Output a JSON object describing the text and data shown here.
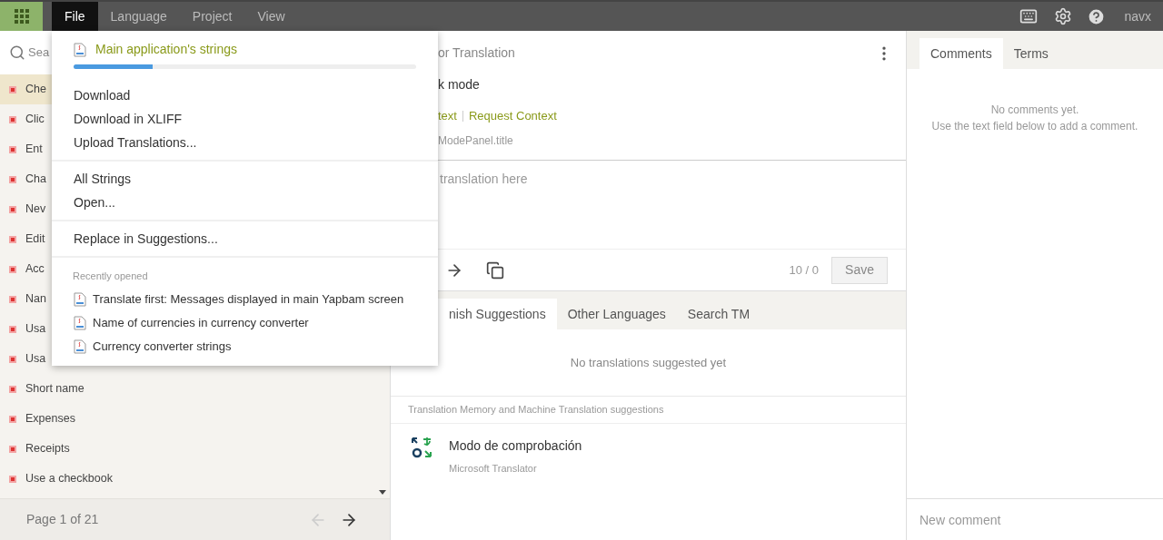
{
  "menubar": {
    "items": [
      {
        "label": "File",
        "selected": true
      },
      {
        "label": "Language",
        "selected": false
      },
      {
        "label": "Project",
        "selected": false
      },
      {
        "label": "View",
        "selected": false
      }
    ],
    "user": "navx"
  },
  "sidebar": {
    "search_placeholder": "Sea",
    "items": [
      {
        "label": "Che",
        "selected": true
      },
      {
        "label": "Clic",
        "selected": false
      },
      {
        "label": "Ent",
        "selected": false
      },
      {
        "label": "Cha",
        "selected": false
      },
      {
        "label": "Nev",
        "selected": false
      },
      {
        "label": "Edit",
        "selected": false
      },
      {
        "label": "Acc",
        "selected": false
      },
      {
        "label": "Nan",
        "selected": false
      },
      {
        "label": "Usa",
        "selected": false
      },
      {
        "label": "Usa",
        "selected": false
      },
      {
        "label": "Short name",
        "selected": false
      },
      {
        "label": "Expenses",
        "selected": false
      },
      {
        "label": "Receipts",
        "selected": false
      },
      {
        "label": "Use a checkbook",
        "selected": false
      }
    ],
    "pager": "Page 1 of 21"
  },
  "file_menu": {
    "file": {
      "name": "Main application's strings",
      "level": 0.23
    },
    "groups": [
      [
        "Download",
        "Download in XLIFF",
        "Upload Translations..."
      ],
      [
        "All Strings",
        "Open..."
      ],
      [
        "Replace in Suggestions..."
      ]
    ],
    "recent_heading": "Recently opened",
    "recent": [
      "Translate first: Messages displayed in main Yapbam screen",
      "Name of currencies in currency converter",
      "Currency converter strings"
    ]
  },
  "editor": {
    "header": "or Translation",
    "source": "k mode",
    "links": [
      "text",
      "Request Context"
    ],
    "key": "ModePanel.title",
    "placeholder": "translation here",
    "counter": "10 / 0",
    "save": "Save"
  },
  "suggestions": {
    "tabs": [
      {
        "label": "nish Suggestions",
        "selected": true
      },
      {
        "label": "Other Languages",
        "selected": false
      },
      {
        "label": "Search TM",
        "selected": false
      }
    ],
    "empty": "No translations suggested yet",
    "tm_heading": "Translation Memory and Machine Translation suggestions",
    "items": [
      {
        "text": "Modo de comprobación",
        "source": "Microsoft Translator"
      }
    ]
  },
  "comments": {
    "tabs": [
      {
        "label": "Comments",
        "selected": true
      },
      {
        "label": "Terms",
        "selected": false
      }
    ],
    "empty": [
      "No comments yet.",
      "Use the text field below to add a comment."
    ],
    "placeholder": "New comment"
  }
}
